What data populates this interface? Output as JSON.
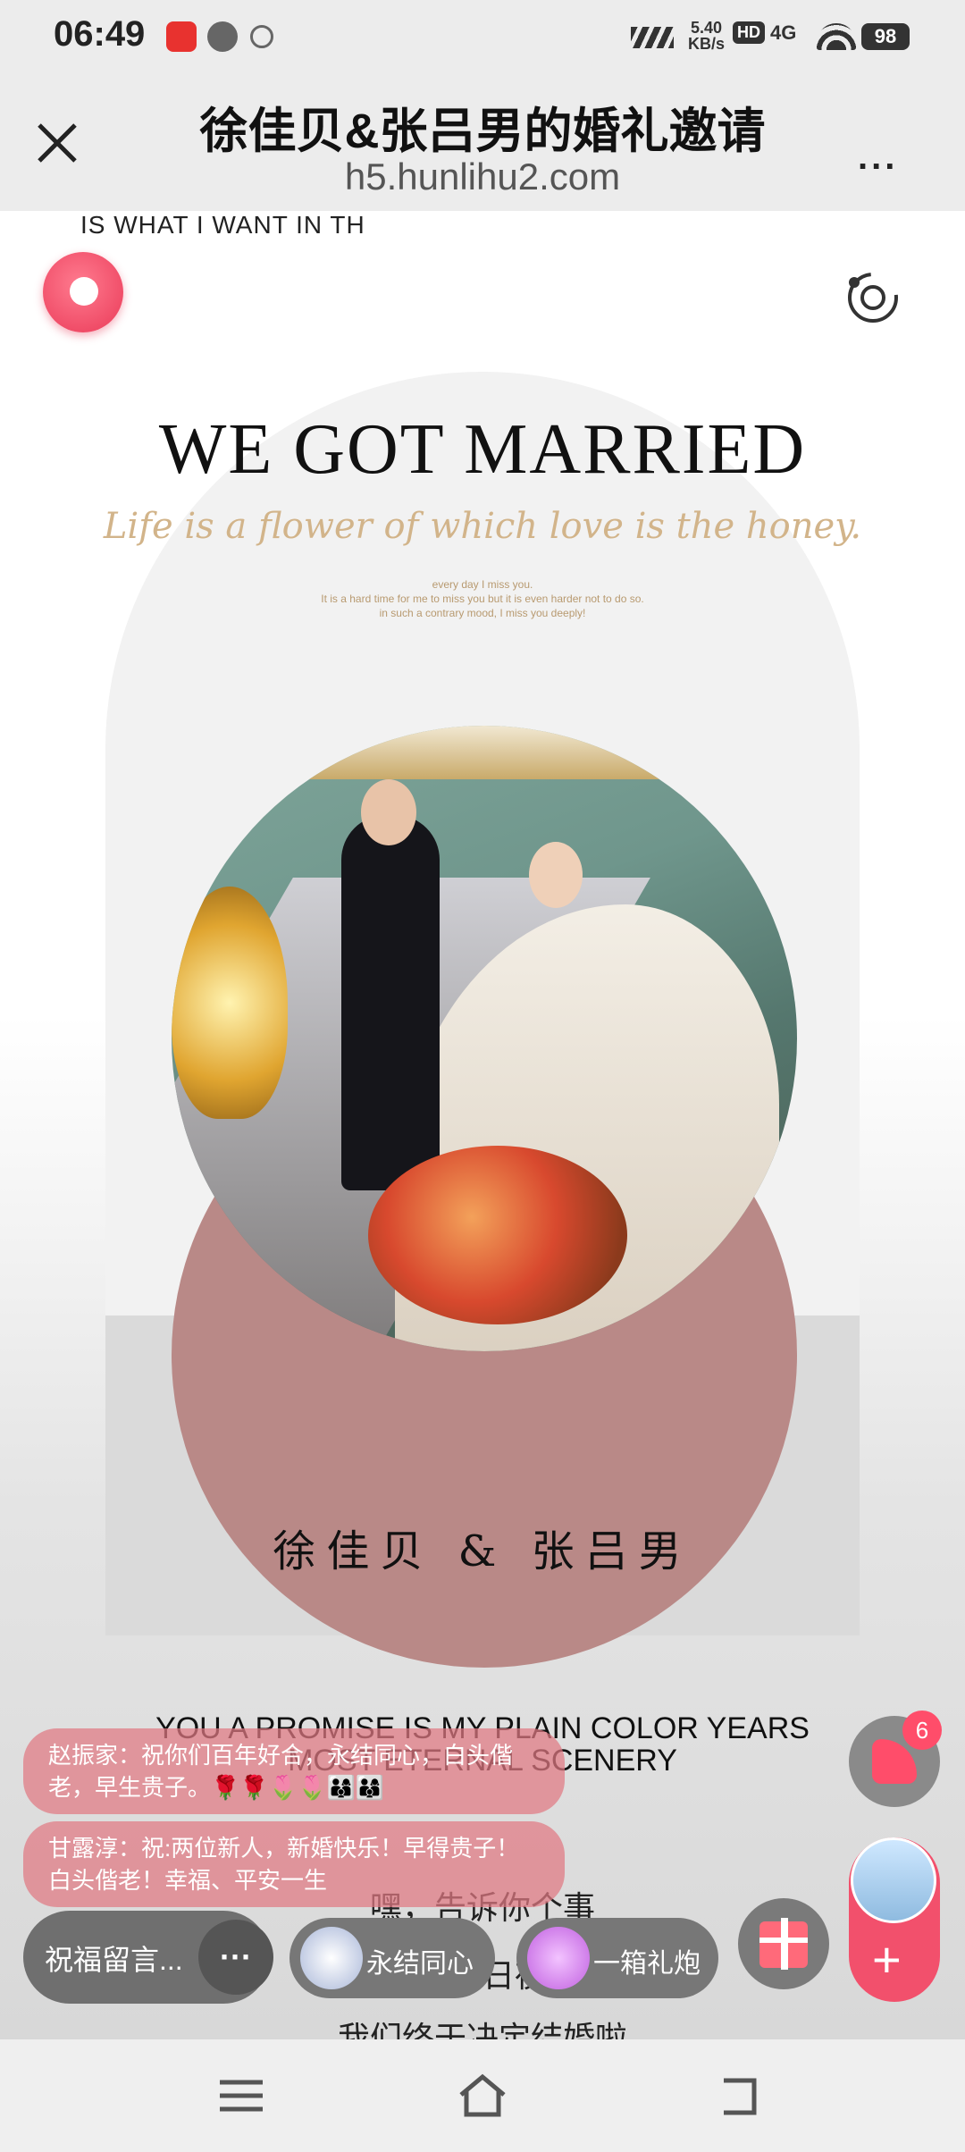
{
  "status_bar": {
    "time": "06:49",
    "net_speed": "5.40",
    "net_unit": "KB/s",
    "hd": "HD",
    "signal": "4G",
    "battery": "98",
    "icons": [
      "app-notification-icon",
      "cat-icon",
      "paw-icon",
      "signal-strength-icon",
      "wifi-icon",
      "battery-icon"
    ]
  },
  "browser": {
    "title": "徐佳贝&张吕男的婚礼邀请",
    "domain": "h5.hunlihu2.com",
    "more": "..."
  },
  "page": {
    "top_clip_text": "IS WHAT I WANT IN TH",
    "headline": "WE GOT MARRIED",
    "script": "Life is a flower of which love is the honey.",
    "small_lines": [
      "every day I miss you.",
      "It is a hard time for me to miss you but it is even harder not to do so.",
      "in such a contrary mood, I miss you deeply!"
    ],
    "names": "徐佳贝 & 张吕男",
    "promise_line1": "YOU A PROMISE IS MY PLAIN COLOR YEARS",
    "promise_line2": "MOST ETERNAL SCENERY",
    "poem1": "嘿，告诉你个事",
    "poem2": "经过无数个日夜的相处",
    "poem3": "我们终于决定结婚啦"
  },
  "barrage": [
    {
      "text": "赵振家：祝你们百年好合，永结同心，白头偕老，早生贵子。🌹🌹🌷🌷👨‍👩‍👦👨‍👩‍👦"
    },
    {
      "text": "甘露淳：祝:两位新人，新婚快乐！早得贵子！白头偕老！幸福、平安一生"
    }
  ],
  "controls": {
    "message_label": "祝福留言...",
    "message_more": "···",
    "gift1_label": "永结同心",
    "gift2_label": "一箱礼炮",
    "like_count": "6",
    "plus": "+"
  },
  "colors": {
    "accent_pink": "#f2506c",
    "photo_backdrop": "#b98987",
    "script_gold": "#d2b48a"
  }
}
